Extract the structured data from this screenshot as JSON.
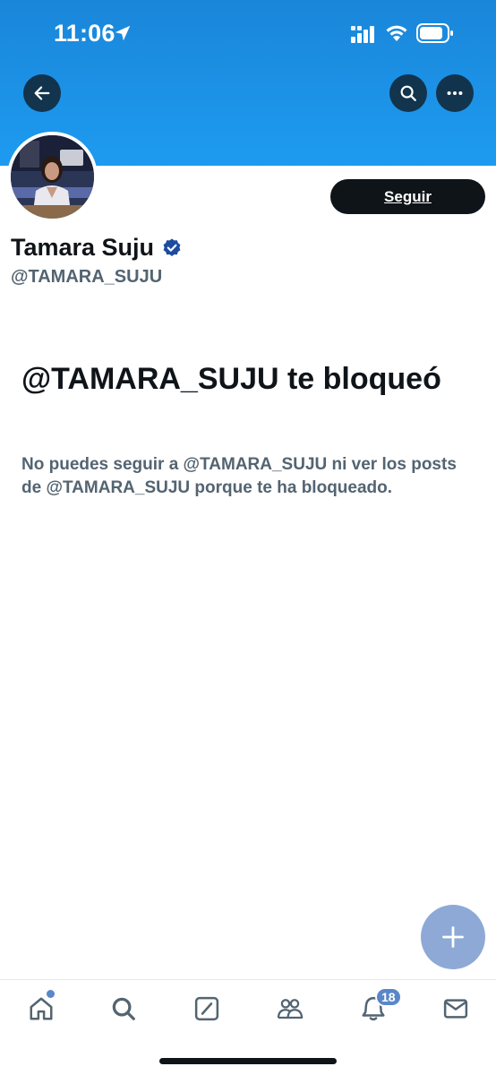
{
  "status_bar": {
    "time": "11:06"
  },
  "profile": {
    "display_name": "Tamara Suju",
    "handle": "@TAMARA_SUJU",
    "follow_label": "Seguir"
  },
  "blocked": {
    "title": "@TAMARA_SUJU te bloqueó",
    "description": "No puedes seguir a @TAMARA_SUJU ni ver los posts de @TAMARA_SUJU porque te ha bloqueado."
  },
  "tab_bar": {
    "notifications_count": "18",
    "items": [
      "home-icon",
      "search-icon",
      "compose-icon",
      "communities-icon",
      "notifications-icon",
      "messages-icon"
    ]
  },
  "colors": {
    "banner": "#1d9bf0",
    "accent": "#5a87c8",
    "fab": "#8ea9d6",
    "text": "#0f1419",
    "secondary": "#536471"
  }
}
